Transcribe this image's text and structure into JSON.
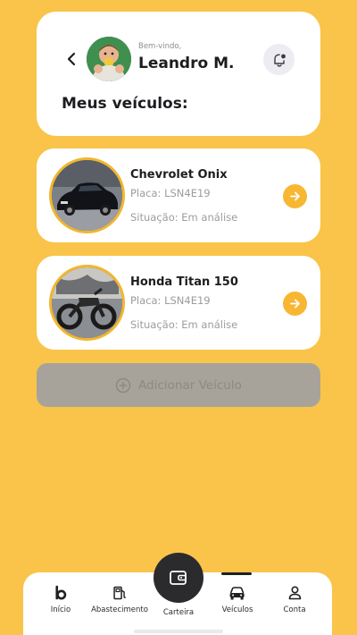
{
  "header": {
    "greeting": "Bem-vindo,",
    "username": "Leandro M.",
    "section_title": "Meus veículos:",
    "back_icon": "chevron-left-icon",
    "bell_icon": "bell-notification-icon"
  },
  "vehicles": [
    {
      "name": "Chevrolet Onix",
      "plate": "Placa: LSN4E19",
      "status": "Situação: Em análise"
    },
    {
      "name": "Honda Titan 150",
      "plate": "Placa: LSN4E19",
      "status": "Situação: Em análise"
    }
  ],
  "add_vehicle": {
    "label": "Adicionar Veículo",
    "icon": "plus-circle-icon"
  },
  "bottom_nav": {
    "items": [
      {
        "label": "Início",
        "icon": "brand-b-icon"
      },
      {
        "label": "Abastecimento",
        "icon": "fuel-pump-icon"
      },
      {
        "label": "Carteira",
        "icon": "wallet-icon"
      },
      {
        "label": "Veículos",
        "icon": "car-icon"
      },
      {
        "label": "Conta",
        "icon": "user-icon"
      }
    ],
    "active": "Veículos"
  },
  "colors": {
    "background": "#F9C449",
    "accent": "#F7B733",
    "card": "#FFFFFF",
    "disabled_button": "#A8A39A",
    "dark": "#2B2B2E"
  }
}
